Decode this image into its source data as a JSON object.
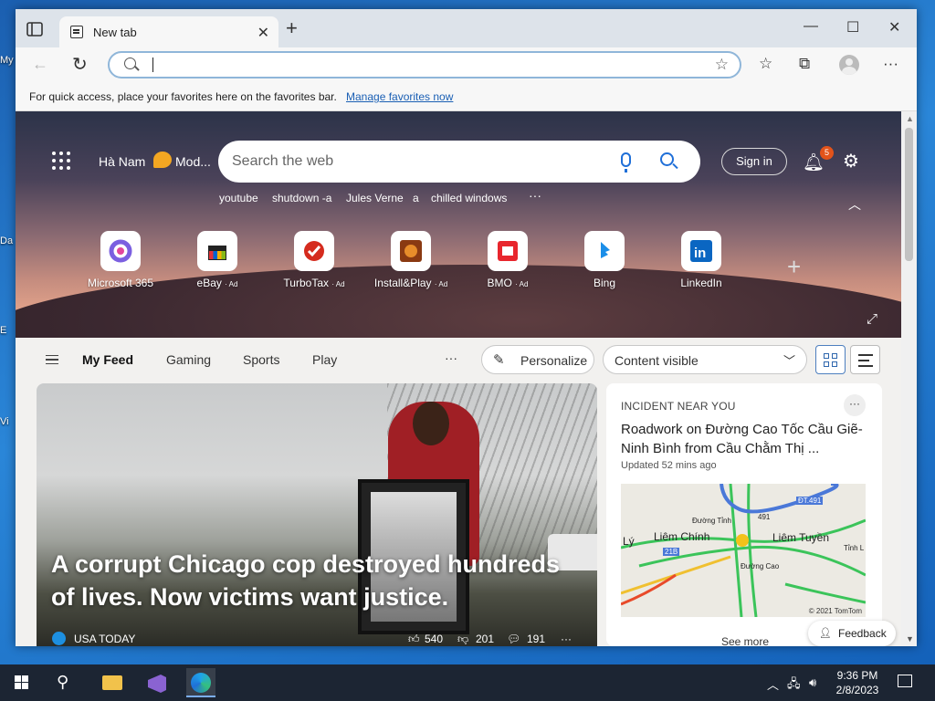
{
  "desktop": {
    "labels": [
      "My",
      "Da",
      "E",
      "Vi"
    ]
  },
  "browser": {
    "tab_title": "New tab",
    "tab_close": "✕",
    "new_tab": "+",
    "window_controls": {
      "minimize": "—",
      "maximize": "☐",
      "close": "✕"
    },
    "address_placeholder": "",
    "favorites_bar_msg": "For quick access, place your favorites here on the favorites bar.",
    "manage_favorites": "Manage favorites now"
  },
  "hero": {
    "location": "Hà Nam",
    "weather_text": "Mod...",
    "search_placeholder": "Search the web",
    "sign_in": "Sign in",
    "notification_count": "5",
    "trending": [
      "youtube",
      "shutdown -a",
      "Jules Verne",
      "a",
      "chilled windows"
    ],
    "trending_more": "···",
    "tiles": [
      {
        "label": "Microsoft 365",
        "ad": ""
      },
      {
        "label": "eBay",
        "ad": "· Ad"
      },
      {
        "label": "TurboTax",
        "ad": "· Ad"
      },
      {
        "label": "Install&Play",
        "ad": "· Ad"
      },
      {
        "label": "BMO",
        "ad": "· Ad"
      },
      {
        "label": "Bing",
        "ad": ""
      },
      {
        "label": "LinkedIn",
        "ad": ""
      }
    ],
    "add_tile": "+"
  },
  "feednav": {
    "tabs": [
      "My Feed",
      "Gaming",
      "Sports",
      "Play"
    ],
    "more": "···",
    "personalize": "Personalize",
    "content_visibility": "Content visible"
  },
  "story": {
    "headline": "A corrupt Chicago cop destroyed hundreds of lives. Now victims want justice.",
    "source": "USA TODAY",
    "likes": "540",
    "dislikes": "201",
    "comments": "191",
    "more": "···"
  },
  "incident": {
    "category": "INCIDENT NEAR YOU",
    "title": "Roadwork on Đường Cao Tốc Cầu Giẽ-Ninh Bình from Cầu Chằm Thị ...",
    "updated": "Updated 52 mins ago",
    "map_labels": {
      "a": "Liêm Chính",
      "b": "Liêm Tuyền",
      "c": "Lý",
      "d": "Đường Tỉnh",
      "e": "ĐT.491",
      "f": "Đường Cao",
      "g": "21B",
      "h": "Tỉnh L",
      "i": "491"
    },
    "map_copyright": "© 2021 TomTom",
    "see_more": "See more"
  },
  "feedback": "Feedback",
  "taskbar": {
    "time": "9:36 PM",
    "date": "2/8/2023"
  },
  "colors": {
    "accent": "#1f6fd8",
    "taskbar": "#1c2533",
    "badge": "#e2531a"
  }
}
